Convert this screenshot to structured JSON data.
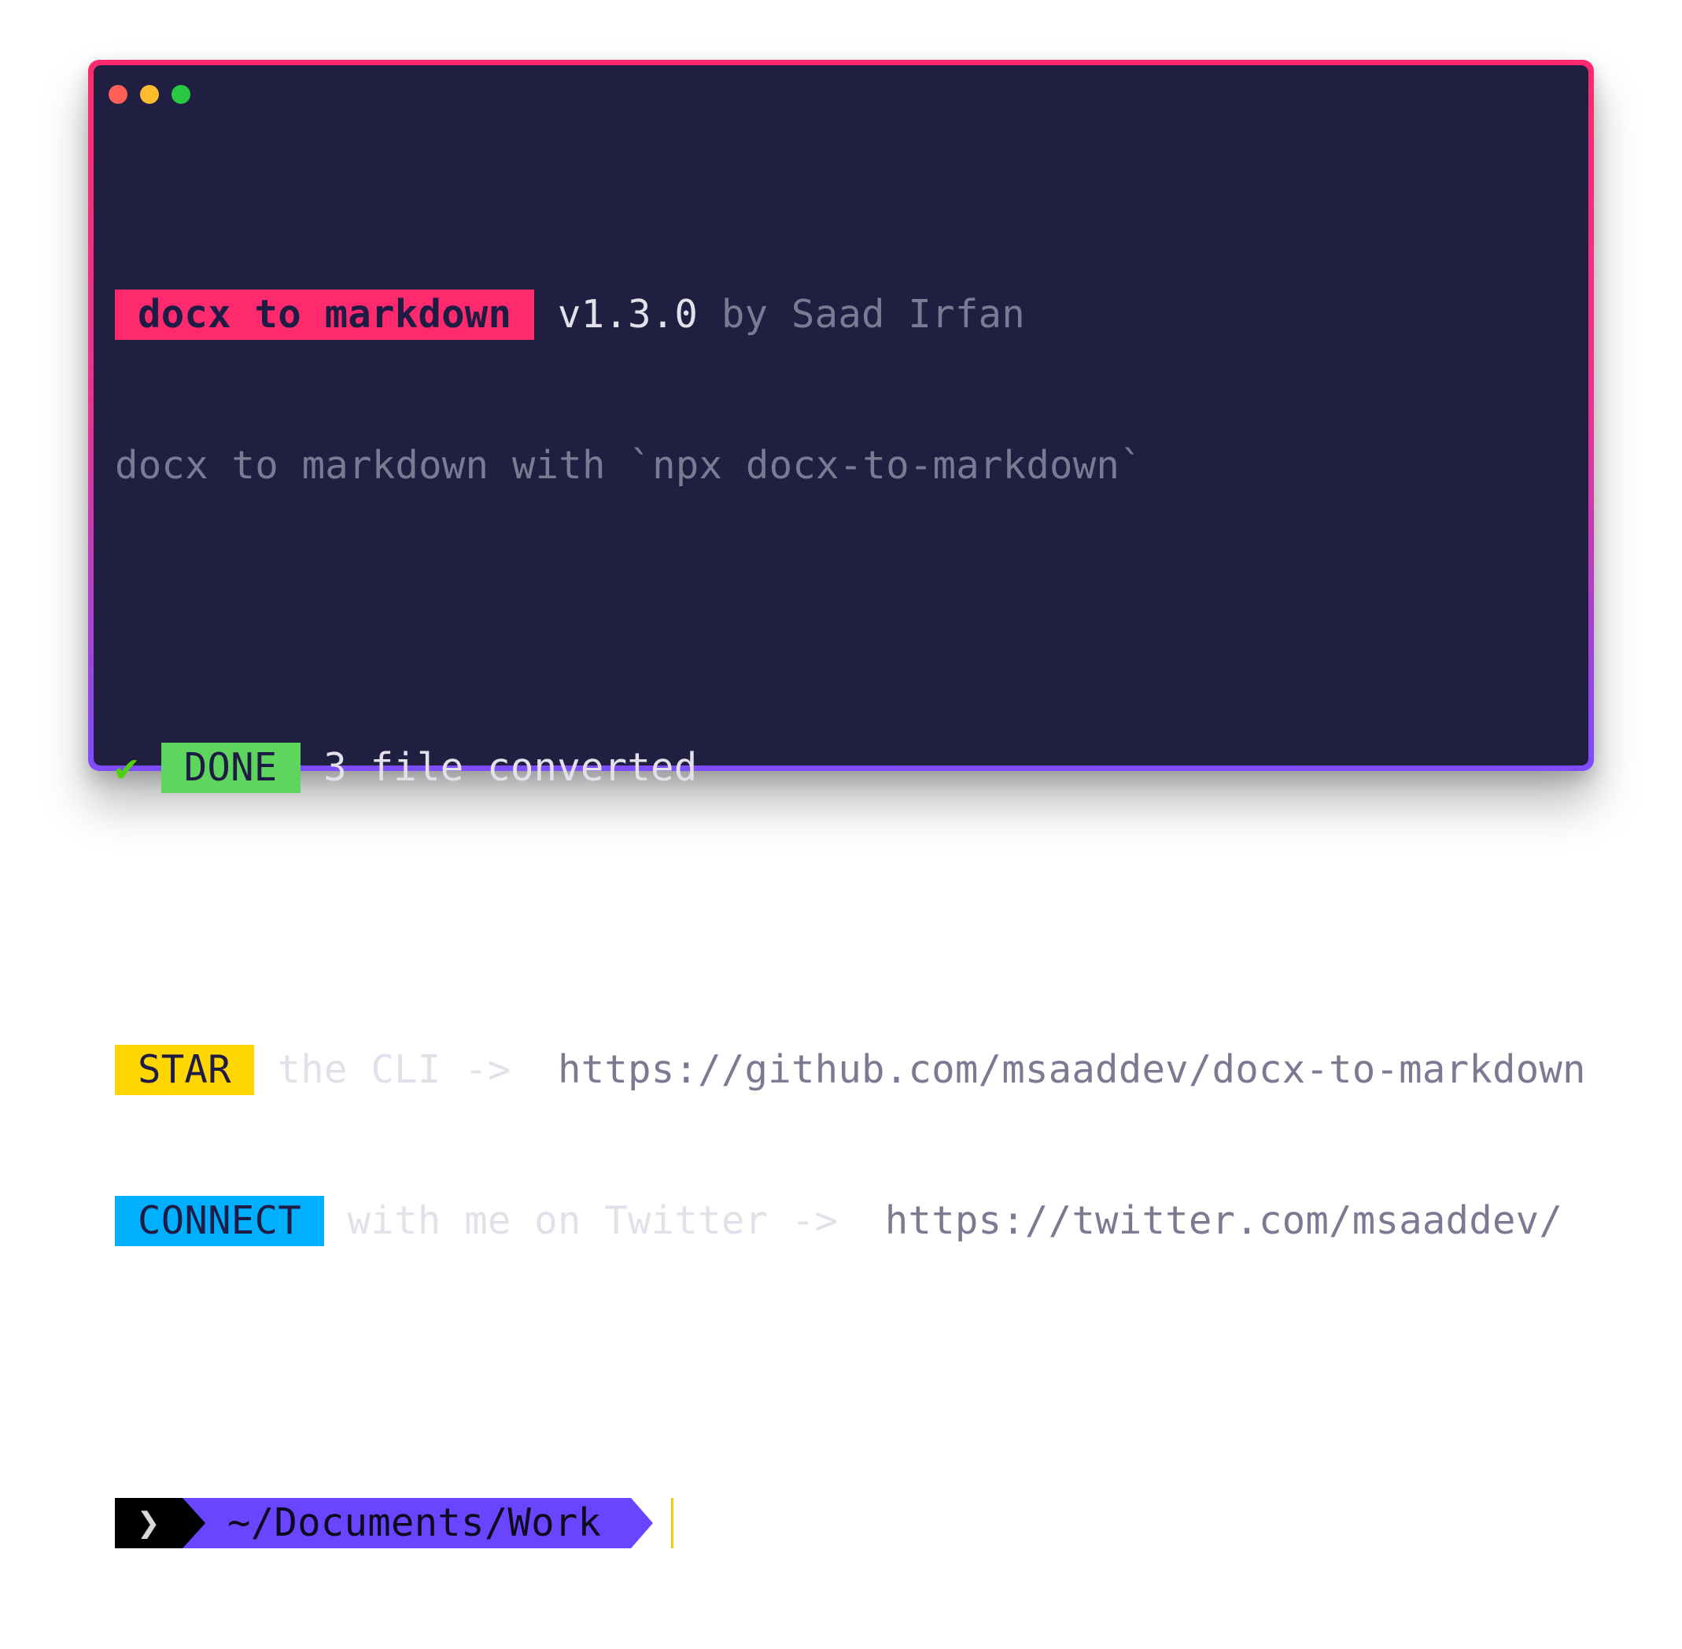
{
  "window": {
    "controls": [
      {
        "name": "close",
        "color": "#ff5f57"
      },
      {
        "name": "minimize",
        "color": "#febc2e"
      },
      {
        "name": "maximize",
        "color": "#28c840"
      }
    ],
    "border_gradient": [
      "#ff2a6d",
      "#7c4dff"
    ],
    "background": "#201f42"
  },
  "header": {
    "app_name": "docx to markdown",
    "app_name_color": "#ff2a6d",
    "version": "v1.3.0",
    "author": "by Saad Irfan",
    "description": "docx to markdown with `npx docx-to-markdown`"
  },
  "status": {
    "check_icon": "✔",
    "badge_label": "DONE",
    "badge_color": "#5ed65e",
    "message": "3 file converted"
  },
  "links": [
    {
      "badge_label": "STAR",
      "badge_color": "#ffd600",
      "text": "the CLI ->",
      "url": "https://github.com/msaaddev/docx-to-markdown"
    },
    {
      "badge_label": "CONNECT",
      "badge_color": "#00b0ff",
      "text": "with me on Twitter ->",
      "url": "https://twitter.com/msaaddev/"
    }
  ],
  "prompt": {
    "symbol": "❯",
    "path": "~/Documents/Work",
    "path_color": "#6a45ff",
    "cursor_color": "#f5c518"
  }
}
